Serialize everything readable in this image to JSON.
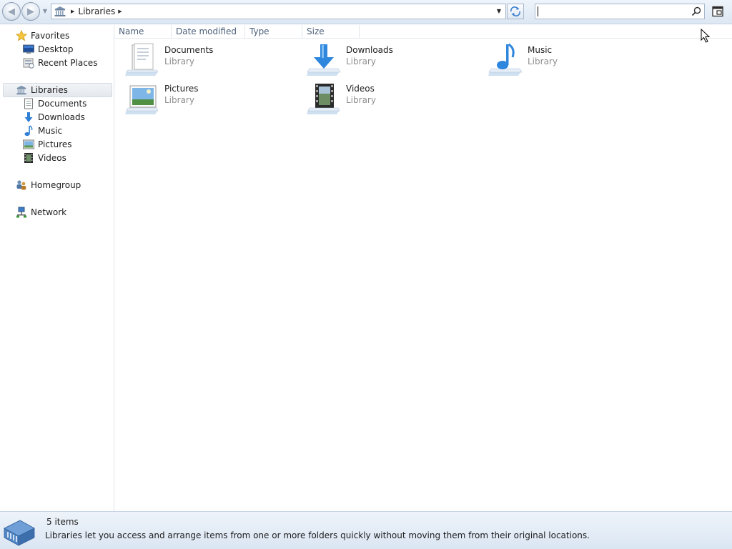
{
  "toolbar": {
    "back_glyph": "◀",
    "forward_glyph": "▶",
    "address_crumb": "Libraries",
    "search_placeholder": "",
    "search_value": ""
  },
  "columns": [
    "Name",
    "Date modified",
    "Type",
    "Size"
  ],
  "nav": {
    "favorites": {
      "label": "Favorites",
      "items": [
        {
          "label": "Desktop",
          "icon": "desktop-icon"
        },
        {
          "label": "Recent Places",
          "icon": "recent-places-icon"
        }
      ]
    },
    "libraries": {
      "label": "Libraries",
      "selected": true,
      "items": [
        {
          "label": "Documents",
          "icon": "documents-icon"
        },
        {
          "label": "Downloads",
          "icon": "downloads-icon"
        },
        {
          "label": "Music",
          "icon": "music-icon"
        },
        {
          "label": "Pictures",
          "icon": "pictures-icon"
        },
        {
          "label": "Videos",
          "icon": "videos-icon"
        }
      ]
    },
    "homegroup": {
      "label": "Homegroup",
      "icon": "homegroup-icon"
    },
    "network": {
      "label": "Network",
      "icon": "network-icon"
    }
  },
  "libraries": [
    {
      "name": "Documents",
      "type": "Library",
      "icon": "documents-library-icon"
    },
    {
      "name": "Downloads",
      "type": "Library",
      "icon": "downloads-library-icon"
    },
    {
      "name": "Music",
      "type": "Library",
      "icon": "music-library-icon"
    },
    {
      "name": "Pictures",
      "type": "Library",
      "icon": "pictures-library-icon"
    },
    {
      "name": "Videos",
      "type": "Library",
      "icon": "videos-library-icon"
    }
  ],
  "status": {
    "count": "5 items",
    "description": "Libraries let you access and arrange items from one or more folders quickly without moving them from their original locations."
  },
  "colors": {
    "toolbar_bg": "#dce7f3",
    "accent_blue": "#2f7fd6",
    "header_text": "#4c607a",
    "subtext": "#8e8e8e"
  }
}
